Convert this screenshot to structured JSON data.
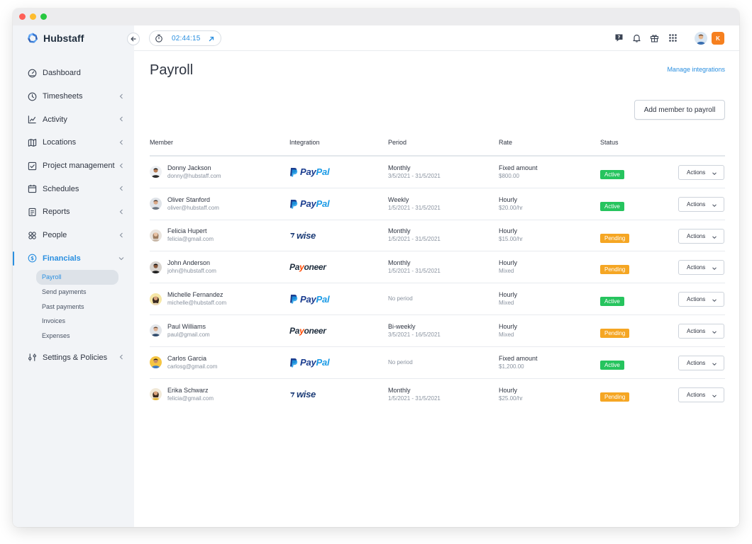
{
  "brand": {
    "name": "Hubstaff"
  },
  "sidebar": {
    "items": [
      {
        "label": "Dashboard",
        "icon": "dashboard-icon",
        "chevron": false
      },
      {
        "label": "Timesheets",
        "icon": "clock-icon",
        "chevron": true
      },
      {
        "label": "Activity",
        "icon": "activity-chart-icon",
        "chevron": true
      },
      {
        "label": "Locations",
        "icon": "map-icon",
        "chevron": true
      },
      {
        "label": "Project management",
        "icon": "checkbox-icon",
        "chevron": true
      },
      {
        "label": "Schedules",
        "icon": "calendar-icon",
        "chevron": true
      },
      {
        "label": "Reports",
        "icon": "report-icon",
        "chevron": true
      },
      {
        "label": "People",
        "icon": "people-icon",
        "chevron": true
      },
      {
        "label": "Financials",
        "icon": "dollar-icon",
        "chevron": true,
        "active": true
      },
      {
        "label": "Settings & Policies",
        "icon": "sliders-icon",
        "chevron": true
      }
    ],
    "financials_sub": [
      {
        "label": "Payroll",
        "active": true
      },
      {
        "label": "Send payments"
      },
      {
        "label": "Past payments"
      },
      {
        "label": "Invoices"
      },
      {
        "label": "Expenses"
      }
    ]
  },
  "topbar": {
    "timer": "02:44:15",
    "icons": [
      "help-icon",
      "bell-icon",
      "gift-icon",
      "apps-grid-icon"
    ],
    "user_initial": "K"
  },
  "page": {
    "title": "Payroll",
    "manage_link": "Manage integrations",
    "add_button": "Add member to payroll"
  },
  "table": {
    "headers": {
      "member": "Member",
      "integration": "Integration",
      "period": "Period",
      "rate": "Rate",
      "status": "Status"
    },
    "actions_label": "Actions",
    "rows": [
      {
        "name": "Donny Jackson",
        "email": "donny@hubstaff.com",
        "integration": "PayPal",
        "period": "Monthly",
        "period_range": "3/5/2021 - 31/5/2021",
        "rate": "Fixed amount",
        "rate_value": "$800.00",
        "status": "Active"
      },
      {
        "name": "Oliver Stanford",
        "email": "oliver@hubstaff.com",
        "integration": "PayPal",
        "period": "Weekly",
        "period_range": "1/5/2021 - 31/5/2021",
        "rate": "Hourly",
        "rate_value": "$20.00/hr",
        "status": "Active"
      },
      {
        "name": "Felicia Hupert",
        "email": "felicia@gmail.com",
        "integration": "Wise",
        "period": "Monthly",
        "period_range": "1/5/2021 - 31/5/2021",
        "rate": "Hourly",
        "rate_value": "$15.00/hr",
        "status": "Pending"
      },
      {
        "name": "John Anderson",
        "email": "john@hubstaff.com",
        "integration": "Payoneer",
        "period": "Monthly",
        "period_range": "1/5/2021 - 31/5/2021",
        "rate": "Hourly",
        "rate_value": "Mixed",
        "status": "Pending"
      },
      {
        "name": "Michelle Fernandez",
        "email": "michelle@hubstaff.com",
        "integration": "PayPal",
        "period": "No period",
        "period_range": "",
        "rate": "Hourly",
        "rate_value": "Mixed",
        "status": "Active"
      },
      {
        "name": "Paul Williams",
        "email": "paul@gmail.com",
        "integration": "Payoneer",
        "period": "Bi-weekly",
        "period_range": "3/5/2021 - 16/5/2021",
        "rate": "Hourly",
        "rate_value": "Mixed",
        "status": "Pending"
      },
      {
        "name": "Carlos Garcia",
        "email": "carlosg@gmail.com",
        "integration": "PayPal",
        "period": "No period",
        "period_range": "",
        "rate": "Fixed amount",
        "rate_value": "$1,200.00",
        "status": "Active"
      },
      {
        "name": "Erika Schwarz",
        "email": "felicia@gmail.com",
        "integration": "Wise",
        "period": "Monthly",
        "period_range": "1/5/2021 - 31/5/2021",
        "rate": "Hourly",
        "rate_value": "$25.00/hr",
        "status": "Pending"
      }
    ]
  },
  "colors": {
    "accent": "#2a8fe0",
    "active": "#26c45e",
    "pending": "#f5a623",
    "user_badge": "#f6801f"
  }
}
